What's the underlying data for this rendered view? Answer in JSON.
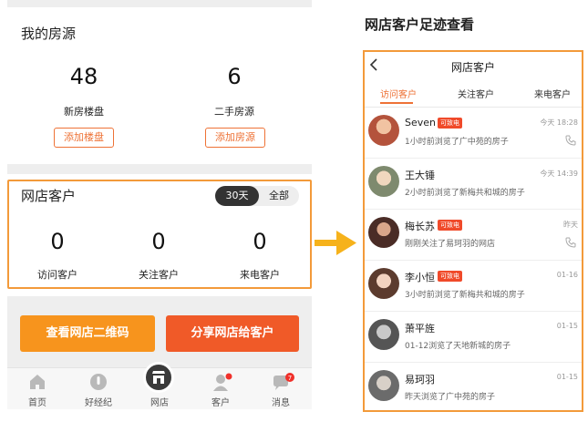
{
  "left": {
    "listings_title": "我的房源",
    "new_homes": {
      "count": "48",
      "label": "新房楼盘",
      "button": "添加楼盘"
    },
    "second_hand": {
      "count": "6",
      "label": "二手房源",
      "button": "添加房源"
    },
    "shop_title": "网店客户",
    "period": {
      "active": "30天",
      "inactive": "全部"
    },
    "stats": [
      {
        "count": "0",
        "label": "访问客户"
      },
      {
        "count": "0",
        "label": "关注客户"
      },
      {
        "count": "0",
        "label": "来电客户"
      }
    ],
    "qr_button": "查看网店二维码",
    "share_button": "分享网店给客户",
    "tabs": [
      {
        "label": "首页",
        "icon": "home-icon"
      },
      {
        "label": "好经纪",
        "icon": "agent-icon"
      },
      {
        "label": "网店",
        "icon": "store-icon"
      },
      {
        "label": "客户",
        "icon": "customer-icon"
      },
      {
        "label": "消息",
        "icon": "message-icon",
        "badge": "7"
      }
    ],
    "colors": {
      "accent": "#ee7236",
      "qr_button": "#f7941d",
      "share_button": "#f05a28",
      "highlight_border": "#f39a3a"
    }
  },
  "right": {
    "heading": "网店客户足迹查看",
    "title": "网店客户",
    "tabs": [
      "访问客户",
      "关注客户",
      "来电客户"
    ],
    "active_tab": "访问客户",
    "customers": [
      {
        "name": "Seven",
        "badge": "可致电",
        "desc": "1小时前浏览了广中苑的房子",
        "time": "今天 18:28",
        "phone": true
      },
      {
        "name": "王大锤",
        "badge": "",
        "desc": "2小时前浏览了新梅共和城的房子",
        "time": "今天 14:39",
        "phone": false
      },
      {
        "name": "梅长苏",
        "badge": "可致电",
        "desc": "刚刚关注了易珂羽的网店",
        "time": "昨天",
        "phone": true
      },
      {
        "name": "李小恒",
        "badge": "可致电",
        "desc": "3小时前浏览了新梅共和城的房子",
        "time": "01-16",
        "phone": false
      },
      {
        "name": "萧平旌",
        "badge": "",
        "desc": "01-12浏览了天地新城的房子",
        "time": "01-15",
        "phone": false
      },
      {
        "name": "易珂羽",
        "badge": "",
        "desc": "昨天浏览了广中苑的房子",
        "time": "01-15",
        "phone": false
      }
    ]
  }
}
